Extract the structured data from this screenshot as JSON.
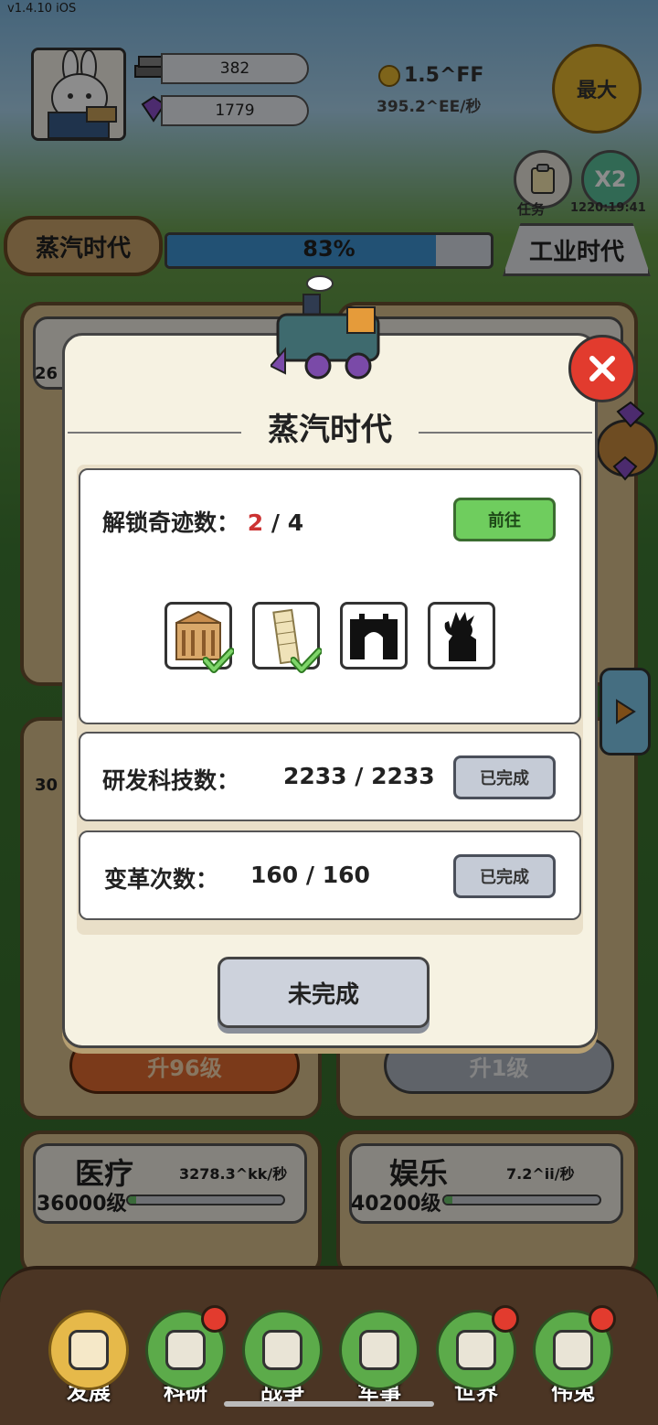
{
  "version": "v1.4.10 iOS",
  "resources": {
    "bars": "382",
    "gems": "1779",
    "coins": "1.5^FF",
    "coin_rate": "395.2^EE/秒"
  },
  "max_button": "最大",
  "task_label": "任务",
  "boost": {
    "label": "X2",
    "timer": "1220:19:41"
  },
  "era": {
    "current": "蒸汽时代",
    "next": "工业时代",
    "progress_text": "83%",
    "progress_value": 0.83
  },
  "bg_cards": {
    "left_top_level": "26",
    "left_mid_level": "30",
    "left_upgrade": "升96级",
    "right_upgrade": "升1级",
    "medical": {
      "title": "医疗",
      "rate": "3278.3^kk/秒",
      "level": "36000级"
    },
    "entertainment": {
      "title": "娱乐",
      "rate": "7.2^ii/秒",
      "level": "40200级"
    }
  },
  "modal": {
    "title": "蒸汽时代",
    "wonders": {
      "label": "解锁奇迹数：",
      "current": "2",
      "separator": "/",
      "total": "4",
      "button": "前往",
      "items": [
        {
          "icon": "treasury-wonder-icon",
          "unlocked": true
        },
        {
          "icon": "leaning-tower-wonder-icon",
          "unlocked": true
        },
        {
          "icon": "gate-wonder-silhouette-icon",
          "unlocked": false
        },
        {
          "icon": "statue-liberty-silhouette-icon",
          "unlocked": false
        }
      ]
    },
    "tech": {
      "label": "研发科技数：",
      "value": "2233 / 2233",
      "button": "已完成"
    },
    "reform": {
      "label": "变革次数：",
      "value": "160 / 160",
      "button": "已完成"
    },
    "footer_button": "未完成"
  },
  "nav": [
    {
      "label": "发展",
      "active": true,
      "badge": false
    },
    {
      "label": "科研",
      "active": false,
      "badge": true
    },
    {
      "label": "战争",
      "active": false,
      "badge": false
    },
    {
      "label": "军事",
      "active": false,
      "badge": false
    },
    {
      "label": "世界",
      "active": false,
      "badge": true
    },
    {
      "label": "伟兔",
      "active": false,
      "badge": true
    }
  ],
  "colors": {
    "accent_green": "#6fcd5e",
    "close_red": "#e23b2e",
    "progress_blue": "#3f94d4"
  }
}
